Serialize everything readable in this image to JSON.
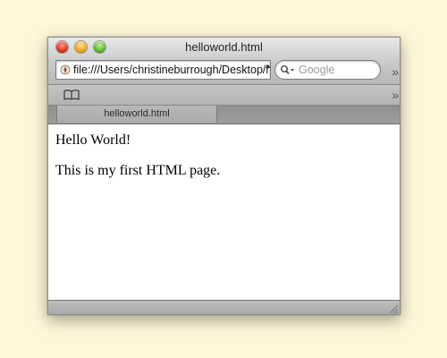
{
  "window": {
    "title": "helloworld.html"
  },
  "toolbar": {
    "url_value": "file:///Users/christineburrough/Desktop/helloworld.html",
    "search_placeholder": "Google",
    "overflow": "»"
  },
  "bookmarks_bar": {
    "overflow": "»"
  },
  "tabs": [
    {
      "label": "helloworld.html",
      "active": true
    }
  ],
  "page": {
    "paragraphs": [
      "Hello World!",
      "This is my first HTML page."
    ]
  },
  "icons": {
    "close": "close-button-red",
    "minimize": "minimize-button-yellow",
    "zoom": "zoom-button-green",
    "site": "file-icon",
    "search": "search-icon",
    "bookmarks": "book-icon",
    "resize": "resize-grip-icon"
  }
}
